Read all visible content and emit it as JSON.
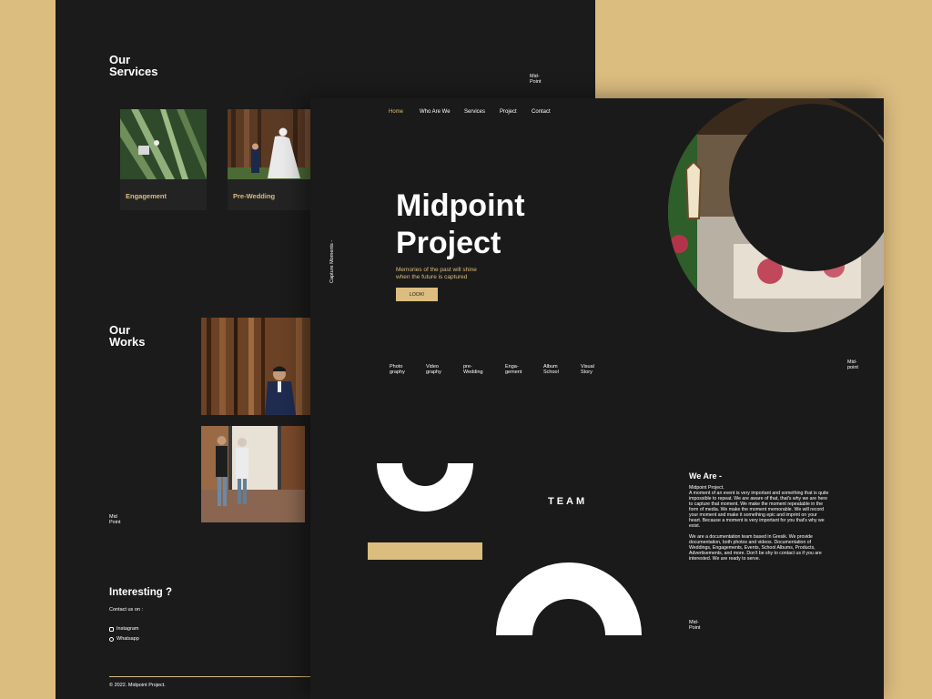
{
  "back_page": {
    "services_title": "Our\nServices",
    "midpoint_mark": "Mid-\nPoint",
    "services": [
      {
        "label": "Engagement"
      },
      {
        "label": "Pre-Wedding"
      }
    ],
    "works_title": "Our\nWorks",
    "midpoint_mark_2": "Mid\nPoint",
    "interesting_title": "Interesting ?",
    "contact_label": "Contact us on :",
    "contacts": [
      {
        "label": "Instagram",
        "icon": "instagram-icon"
      },
      {
        "label": "Whatsapp",
        "icon": "whatsapp-icon"
      }
    ],
    "copyright": "© 2022. Midpoint Project."
  },
  "front_page": {
    "nav": [
      "Home",
      "Who Are We",
      "Services",
      "Project",
      "Contact"
    ],
    "hero_title": "Midpoint\nProject",
    "hero_subtitle": "Memories of the past will shine\nwhen the future is captured",
    "cta": "LOOK!",
    "vertical_text": "Capture Moments -",
    "categories": [
      "Photo\ngraphy",
      "Video\ngraphy",
      "pre-\nWedding",
      "Enga-\ngement",
      "Album\nSchool",
      "Visual\nStory"
    ],
    "midpoint_mark": "Mid-\npoint",
    "team_label": "TEAM",
    "we_are_title": "We Are -",
    "we_are_body": "Midpoint Project.\nA moment of an event is very important and something that is quite impossible to repeat. We are aware of that, that's why we are here to capture that moment. We make the moment repeatable in the form of media. We make the moment memorable. We will record your moment and make it something epic and imprint on your heart. Because a moment is very important for you that's why we exist.\n\nWe are a documentation team based in Gresik. We provide documentation, both photos and videos. Documentation of Weddings, Engagements, Events, School Albums, Products, Advertisements, and more. Don't be shy to contact us if you are interested. We are ready to serve.",
    "midpoint_mark_2": "Mid-\nPoint"
  },
  "colors": {
    "background": "#dcbd80",
    "page": "#1a1a1a",
    "accent": "#dcbd80",
    "text": "#ffffff"
  }
}
